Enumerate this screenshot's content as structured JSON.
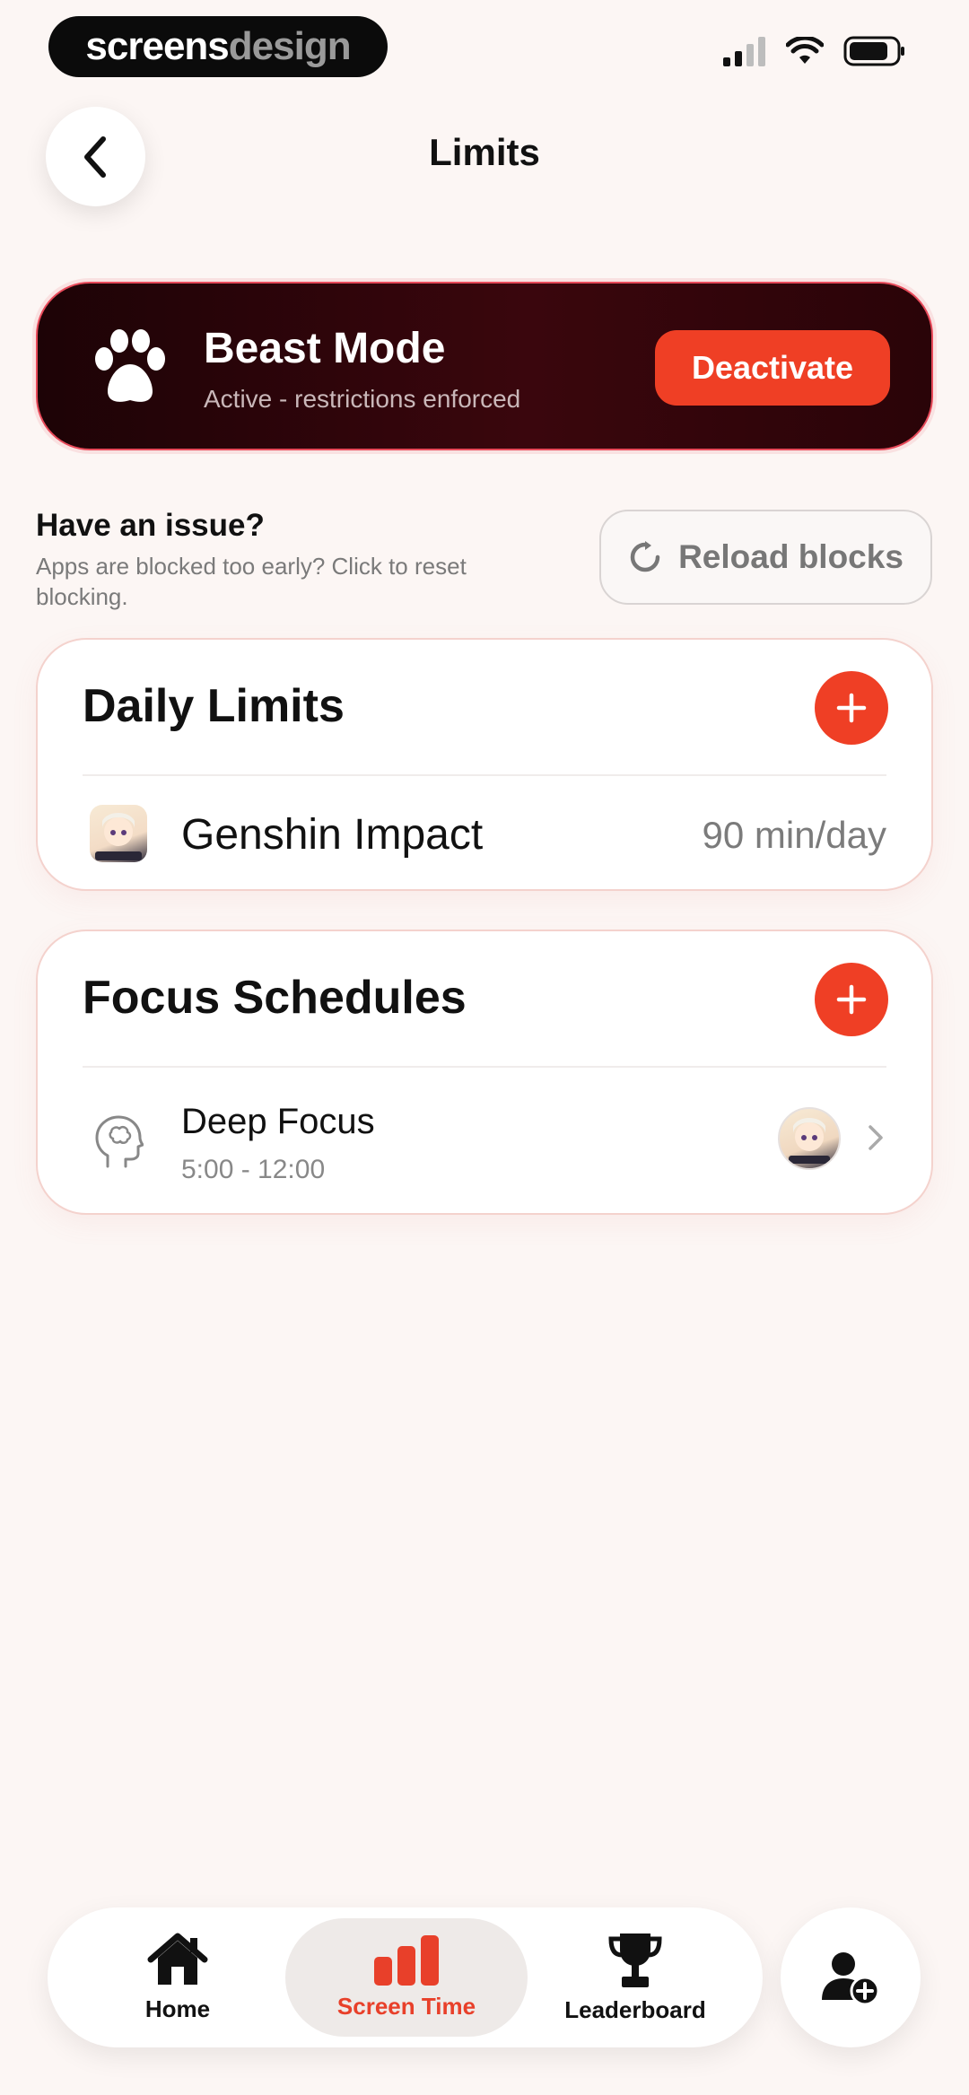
{
  "brand": {
    "part1": "screens",
    "part2": "design"
  },
  "header": {
    "title": "Limits"
  },
  "beast_mode": {
    "title": "Beast Mode",
    "subtitle": "Active - restrictions enforced",
    "action_label": "Deactivate"
  },
  "issue": {
    "title": "Have an issue?",
    "description": "Apps are blocked too early? Click to reset blocking.",
    "reload_label": "Reload blocks"
  },
  "daily_limits": {
    "title": "Daily Limits",
    "items": [
      {
        "app": "Genshin Impact",
        "limit": "90 min/day"
      }
    ]
  },
  "focus_schedules": {
    "title": "Focus Schedules",
    "items": [
      {
        "name": "Deep Focus",
        "time": "5:00 - 12:00"
      }
    ]
  },
  "nav": {
    "items": [
      {
        "label": "Home",
        "icon": "home-icon"
      },
      {
        "label": "Screen Time",
        "icon": "bar-chart-icon",
        "active": true
      },
      {
        "label": "Leaderboard",
        "icon": "trophy-icon"
      }
    ]
  },
  "colors": {
    "accent": "#ef3f25",
    "banner_dark": "#2a0408",
    "background": "#fcf6f4"
  }
}
